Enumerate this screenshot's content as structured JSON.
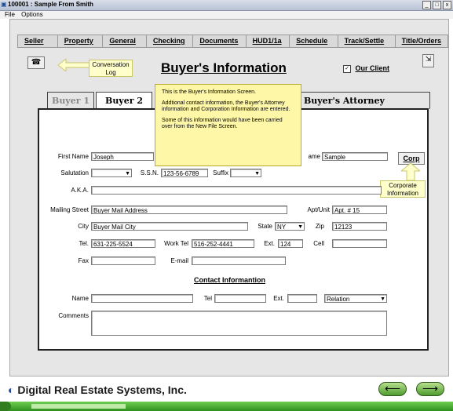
{
  "window": {
    "title": "100001 : Sample From Smith",
    "controls": [
      "_",
      "□",
      "x"
    ]
  },
  "menu": [
    "File",
    "Options"
  ],
  "nav_tabs": [
    "Seller",
    "Property",
    "General",
    "Checking",
    "Documents",
    "HUD1/1a",
    "Schedule",
    "Track/Settle",
    "Title/Orders"
  ],
  "header": {
    "phone_icon": "phone-icon",
    "conversation_log_callout": "Conversation Log",
    "page_title": "Buyer's Information",
    "our_client_label": "Our Client",
    "our_client_checked": true,
    "exit_icon": "exit-icon"
  },
  "sub_tabs": [
    "Buyer 1",
    "Buyer 2",
    "Buyer's Attorney"
  ],
  "tooltip": {
    "line1": "This is the Buyer's Information Screen.",
    "line2": "Addtional contact information, the Buyer's Attorney information and Corporation Information are entered.",
    "line3": "Some of this information would have been carried over from the New File Screen."
  },
  "form": {
    "first_name_label": "First Name",
    "first_name_value": "Joseph",
    "last_name_label": "ame",
    "last_name_value": "Sample",
    "corp_button": "Corp",
    "corporate_callout": "Corporate Information",
    "salutation_label": "Salutation",
    "salutation_value": "",
    "ssn_label": "S.S.N.",
    "ssn_value": "123-56-6789",
    "suffix_label": "Suffix",
    "suffix_value": "",
    "aka_label": "A.K.A.",
    "aka_value": "",
    "mailing_street_label": "Mailing Street",
    "mailing_street_value": "Buyer Mail Address",
    "apt_label": "Apt/Unit",
    "apt_value": "Apt. # 15",
    "city_label": "City",
    "city_value": "Buyer Mail City",
    "state_label": "State",
    "state_value": "NY",
    "zip_label": "Zip",
    "zip_value": "12123",
    "tel_label": "Tel.",
    "tel_value": "631-225-5524",
    "work_tel_label": "Work Tel",
    "work_tel_value": "516-252-4441",
    "ext_label": "Ext.",
    "ext_value": "124",
    "cell_label": "Cell",
    "cell_value": "",
    "fax_label": "Fax",
    "fax_value": "",
    "email_label": "E-mail",
    "email_value": ""
  },
  "contact": {
    "heading": "Contact Informantion",
    "name_label": "Name",
    "name_value": "",
    "tel_label": "Tel",
    "tel_value": "",
    "ext_label": "Ext.",
    "ext_value": "",
    "relation_value": "Relation",
    "comments_label": "Comments",
    "comments_value": ""
  },
  "footer": {
    "company": "Digital Real Estate Systems, Inc.",
    "back_icon": "arrow-left-icon",
    "forward_icon": "arrow-right-icon"
  },
  "colors": {
    "callout_yellow": "#ffffcc",
    "tooltip_yellow": "#fff7a8",
    "nav_green": "#4d9b2e",
    "accent_blue": "#1a4fa0"
  }
}
